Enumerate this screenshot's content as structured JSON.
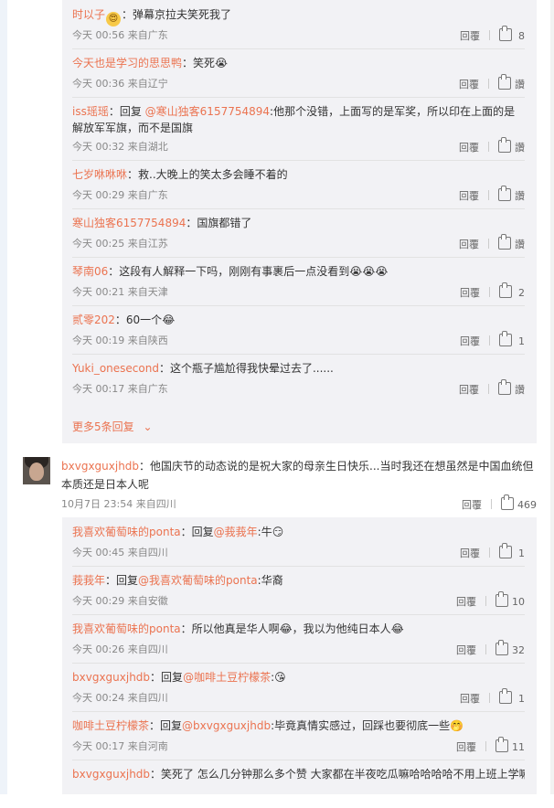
{
  "ui": {
    "reply_label": "回覆",
    "like_label": "讚"
  },
  "group1": {
    "replies": [
      {
        "user": "时以子",
        "emoji": "😍",
        "text": "：弹幕京拉夫笑死我了",
        "time": "今天 00:56",
        "loc": "来自广东",
        "likes": "8"
      },
      {
        "user": "今天也是学习的思思鸭",
        "text": "：笑死",
        "emoji_after": "😭",
        "time": "今天 00:36",
        "loc": "来自辽宁",
        "likes": "讚"
      },
      {
        "user": "iss瑶瑶",
        "text_pre": "：回复 ",
        "mention": "@寒山独客6157754894",
        "text": ":他那个没错，上面写的是军奖，所以印在上面的是解放军军旗，而不是国旗",
        "time": "今天 00:32",
        "loc": "来自湖北",
        "likes": "讚"
      },
      {
        "user": "七岁咻咻咻",
        "text": "：救..大晚上的笑太多会睡不着的",
        "time": "今天 00:29",
        "loc": "来自广东",
        "likes": "讚"
      },
      {
        "user": "寒山独客6157754894",
        "text": "：国旗都错了",
        "time": "今天 00:25",
        "loc": "来自江苏",
        "likes": "讚"
      },
      {
        "user": "琴南06",
        "text": "：这段有人解释一下吗，刚刚有事裹后一点没看到",
        "emoji_after": "😭😭😭",
        "time": "今天 00:21",
        "loc": "来自天津",
        "likes": "2"
      },
      {
        "user": "贰零202",
        "text": "：60一个",
        "emoji_after": "😂",
        "time": "今天 00:19",
        "loc": "来自陕西",
        "likes": "1"
      },
      {
        "user": "Yuki_onesecond",
        "text": "：这个瓶子尴尬得我快晕过去了......",
        "time": "今天 00:17",
        "loc": "来自广东",
        "likes": "讚"
      }
    ],
    "more_label": "更多5条回复",
    "more_chevron": "chevron-down-icon"
  },
  "main_comment": {
    "user": "bxvgxguxjhdb",
    "text": "：他国庆节的动态说的是祝大家的母亲生日快乐...当时我还在想虽然是中国血统但本质还是日本人呢",
    "time": "10月7日 23:54",
    "loc": "来自四川",
    "likes": "469"
  },
  "group2": {
    "replies": [
      {
        "user": "我喜欢葡萄味的ponta",
        "text_pre": "：回复",
        "mention": "@莪莪年",
        "text": ":牛",
        "emoji_after": "😏",
        "time": "今天 00:45",
        "loc": "来自四川",
        "likes": "1"
      },
      {
        "user": "莪莪年",
        "text_pre": "：回复",
        "mention": "@我喜欢葡萄味的ponta",
        "text": ":华裔",
        "time": "今天 00:29",
        "loc": "来自安徽",
        "likes": "10"
      },
      {
        "user": "我喜欢葡萄味的ponta",
        "text": "：所以他真是华人啊",
        "emoji_after": "😂",
        "text2": "，我以为他纯日本人",
        "emoji_after2": "😂",
        "time": "今天 00:26",
        "loc": "来自四川",
        "likes": "32"
      },
      {
        "user": "bxvgxguxjhdb",
        "text_pre": "：回复",
        "mention": "@咖啡土豆柠檬茶",
        "text": ":",
        "emoji_after": "😘",
        "time": "今天 00:24",
        "loc": "来自四川",
        "likes": "1"
      },
      {
        "user": "咖啡土豆柠檬茶",
        "text_pre": "：回复",
        "mention": "@bxvgxguxjhdb",
        "text": ":毕竟真情实感过，回踩也要彻底一些",
        "emoji_after": "🤭",
        "time": "今天 00:17",
        "loc": "来自河南",
        "likes": "11"
      },
      {
        "user": "bxvgxguxjhdb",
        "text": "：笑死了 怎么几分钟那么多个赞 大家都在半夜吃瓜嘛哈哈哈哈不用上班上学嘛",
        "time": "",
        "loc": "",
        "likes": ""
      }
    ]
  }
}
